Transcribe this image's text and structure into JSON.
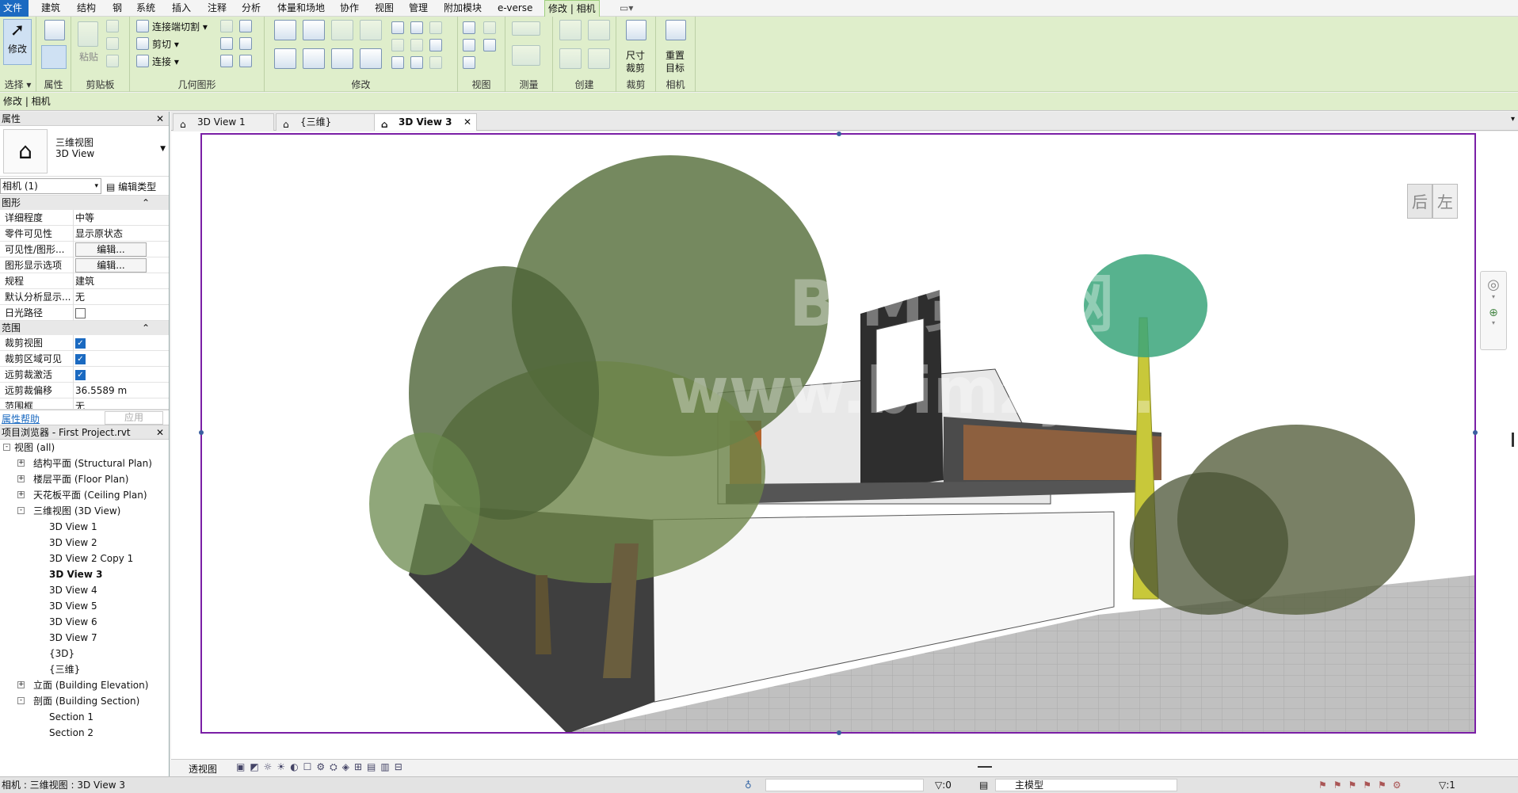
{
  "menu": {
    "items": [
      "文件",
      "建筑",
      "结构",
      "钢",
      "系统",
      "插入",
      "注释",
      "分析",
      "体量和场地",
      "协作",
      "视图",
      "管理",
      "附加模块",
      "e-verse",
      "修改 | 相机"
    ]
  },
  "ribbon": {
    "modify_label": "修改",
    "properties_label": "属性",
    "paste_label": "粘贴",
    "join_cut": "连接端切割",
    "cut": "剪切",
    "join": "连接",
    "crop_size": "尺寸\n裁剪",
    "crop_size_1": "尺寸",
    "crop_size_2": "裁剪",
    "reset_target_1": "重置",
    "reset_target_2": "目标",
    "panels": {
      "select": "选择",
      "properties": "属性",
      "clipboard": "剪贴板",
      "geometry": "几何图形",
      "modify": "修改",
      "view": "视图",
      "measure": "测量",
      "create": "创建",
      "crop": "裁剪",
      "camera": "相机"
    }
  },
  "context": {
    "title": "修改 | 相机"
  },
  "properties": {
    "title": "属性",
    "type_name_cn": "三维视图",
    "type_name_en": "3D View",
    "selector": "相机 (1)",
    "edit_type": "编辑类型",
    "groups": {
      "graphics": "图形",
      "extents": "范围"
    },
    "rows": [
      {
        "k": "详细程度",
        "v": "中等"
      },
      {
        "k": "零件可见性",
        "v": "显示原状态"
      },
      {
        "k": "可见性/图形...",
        "v": "编辑..."
      },
      {
        "k": "图形显示选项",
        "v": "编辑..."
      },
      {
        "k": "规程",
        "v": "建筑"
      },
      {
        "k": "默认分析显示...",
        "v": "无"
      },
      {
        "k": "日光路径",
        "v": ""
      }
    ],
    "extents_rows": [
      {
        "k": "裁剪视图",
        "v": ""
      },
      {
        "k": "裁剪区域可见",
        "v": ""
      },
      {
        "k": "远剪裁激活",
        "v": ""
      },
      {
        "k": "远剪裁偏移",
        "v": "36.5589 m"
      },
      {
        "k": "范围框",
        "v": "无"
      }
    ],
    "help": "属性帮助",
    "apply": "应用"
  },
  "browser": {
    "title": "项目浏览器 - First Project.rvt",
    "items": [
      {
        "label": "视图 (all)",
        "level": 0,
        "tog": "-"
      },
      {
        "label": "结构平面 (Structural Plan)",
        "level": 1,
        "tog": "+"
      },
      {
        "label": "楼层平面 (Floor Plan)",
        "level": 1,
        "tog": "+"
      },
      {
        "label": "天花板平面 (Ceiling Plan)",
        "level": 1,
        "tog": "+"
      },
      {
        "label": "三维视图 (3D View)",
        "level": 1,
        "tog": "-"
      },
      {
        "label": "3D View 1",
        "level": 2,
        "tog": ""
      },
      {
        "label": "3D View 2",
        "level": 2,
        "tog": ""
      },
      {
        "label": "3D View 2 Copy 1",
        "level": 2,
        "tog": ""
      },
      {
        "label": "3D View 3",
        "level": 2,
        "tog": "",
        "bold": true
      },
      {
        "label": "3D View 4",
        "level": 2,
        "tog": ""
      },
      {
        "label": "3D View 5",
        "level": 2,
        "tog": ""
      },
      {
        "label": "3D View 6",
        "level": 2,
        "tog": ""
      },
      {
        "label": "3D View 7",
        "level": 2,
        "tog": ""
      },
      {
        "label": "{3D}",
        "level": 2,
        "tog": ""
      },
      {
        "label": "{三维}",
        "level": 2,
        "tog": ""
      },
      {
        "label": "立面 (Building Elevation)",
        "level": 1,
        "tog": "+"
      },
      {
        "label": "剖面 (Building Section)",
        "level": 1,
        "tog": "-"
      },
      {
        "label": "Section 1",
        "level": 2,
        "tog": ""
      },
      {
        "label": "Section 2",
        "level": 2,
        "tog": ""
      }
    ]
  },
  "tabs": [
    {
      "label": "3D View 1"
    },
    {
      "label": "{三维}"
    },
    {
      "label": "3D View 3"
    }
  ],
  "viewcube": {
    "back": "后",
    "left": "左"
  },
  "watermark": {
    "line1": "BIM资源网",
    "line2": "www.bimzyw.com"
  },
  "viewbar": {
    "mode": "透视图"
  },
  "status": {
    "text": "相机 : 三维视图 : 3D View 3",
    "selection": ":0",
    "model": "主模型",
    "filter": ":1"
  }
}
